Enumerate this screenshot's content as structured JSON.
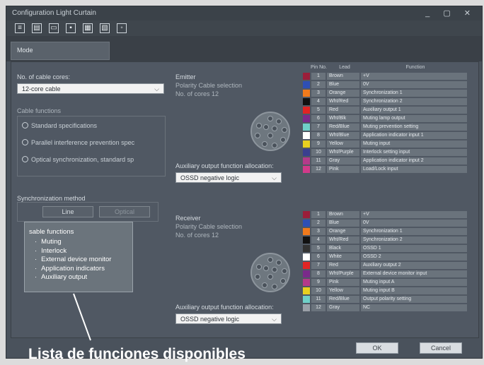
{
  "window": {
    "title": "Configuration Light Curtain",
    "controls": "_ ▢ ✕"
  },
  "toolbar": {
    "icons": [
      "menu-icon",
      "file-icon",
      "folder-icon",
      "save-icon",
      "print-icon",
      "settings-icon",
      "info-icon"
    ]
  },
  "tabs": [
    {
      "label": "Mode"
    }
  ],
  "left_panel": {
    "cables_label": "No. of cable cores:",
    "cables_value": "12-core cable",
    "functions_label": "Cable functions",
    "options": [
      "Standard specifications",
      "Parallel interference prevention spec",
      "Optical synchronization, standard sp"
    ],
    "sync_label": "Synchronization method",
    "sync_buttons": [
      "Line",
      "Optical"
    ]
  },
  "emitter": {
    "title": "Emitter",
    "line1": "Polarity Cable selection",
    "line2": "No. of cores 12",
    "aux_label": "Auxiliary output function allocation:",
    "aux_value": "OSSD negative logic"
  },
  "receiver": {
    "title": "Receiver",
    "line1": "Polarity Cable selection",
    "line2": "No. of cores 12",
    "aux_label": "Auxiliary output function allocation:",
    "aux_value": "OSSD negative logic"
  },
  "wire_table": {
    "headers": [
      "Pin No.",
      "Lead",
      "Function"
    ],
    "emitter_rows": [
      {
        "color": "#9b1e3a",
        "pin": "1",
        "name": "Brown",
        "func": "+V"
      },
      {
        "color": "#2e4fb5",
        "pin": "2",
        "name": "Blue",
        "func": "0V"
      },
      {
        "color": "#f07a1c",
        "pin": "3",
        "name": "Orange",
        "func": "Synchronization 1"
      },
      {
        "color": "#111111",
        "pin": "4",
        "name": "Wht/Red",
        "func": "Synchronization 2"
      },
      {
        "color": "#e02424",
        "pin": "5",
        "name": "Red",
        "func": "Auxiliary output 1"
      },
      {
        "color": "#7a2a8a",
        "pin": "6",
        "name": "Wht/Blk",
        "func": "Muting lamp output"
      },
      {
        "color": "#6fd0c8",
        "pin": "7",
        "name": "Red/Blue",
        "func": "Muting prevention setting"
      },
      {
        "color": "#ffffff",
        "pin": "8",
        "name": "Wht/Blue",
        "func": "Application indicator input 1"
      },
      {
        "color": "#e8d020",
        "pin": "9",
        "name": "Yellow",
        "func": "Muting input"
      },
      {
        "color": "#3a3f8f",
        "pin": "10",
        "name": "Wht/Purple",
        "func": "Interlock setting input"
      },
      {
        "color": "#b43a8a",
        "pin": "11",
        "name": "Gray",
        "func": "Application indicator input 2"
      },
      {
        "color": "#d23a8a",
        "pin": "12",
        "name": "Pink",
        "func": "Load/Lock input"
      }
    ],
    "receiver_rows": [
      {
        "color": "#9b1e3a",
        "pin": "1",
        "name": "Brown",
        "func": "+V"
      },
      {
        "color": "#2e4fb5",
        "pin": "2",
        "name": "Blue",
        "func": "0V"
      },
      {
        "color": "#f07a1c",
        "pin": "3",
        "name": "Orange",
        "func": "Synchronization 1"
      },
      {
        "color": "#111111",
        "pin": "4",
        "name": "Wht/Red",
        "func": "Synchronization 2"
      },
      {
        "color": "#333333",
        "pin": "5",
        "name": "Black",
        "func": "OSSD 1"
      },
      {
        "color": "#ffffff",
        "pin": "6",
        "name": "White",
        "func": "OSSD 2"
      },
      {
        "color": "#e02424",
        "pin": "7",
        "name": "Red",
        "func": "Auxiliary output 2"
      },
      {
        "color": "#7a2a8a",
        "pin": "8",
        "name": "Wht/Purple",
        "func": "External device monitor input"
      },
      {
        "color": "#b43a8a",
        "pin": "9",
        "name": "Pink",
        "func": "Muting input A"
      },
      {
        "color": "#e8d020",
        "pin": "10",
        "name": "Yellow",
        "func": "Muting input B"
      },
      {
        "color": "#6fd0c8",
        "pin": "11",
        "name": "Red/Blue",
        "func": "Output polarity setting"
      },
      {
        "color": "#9aa0a8",
        "pin": "12",
        "name": "Gray",
        "func": "NC"
      }
    ]
  },
  "callout": {
    "title": "sable functions",
    "items": [
      "Muting",
      "Interlock",
      "External device monitor",
      "Application indicators",
      "Auxiliary output"
    ]
  },
  "caption": "Lista de funciones disponibles",
  "footer": {
    "ok": "OK",
    "cancel": "Cancel"
  }
}
